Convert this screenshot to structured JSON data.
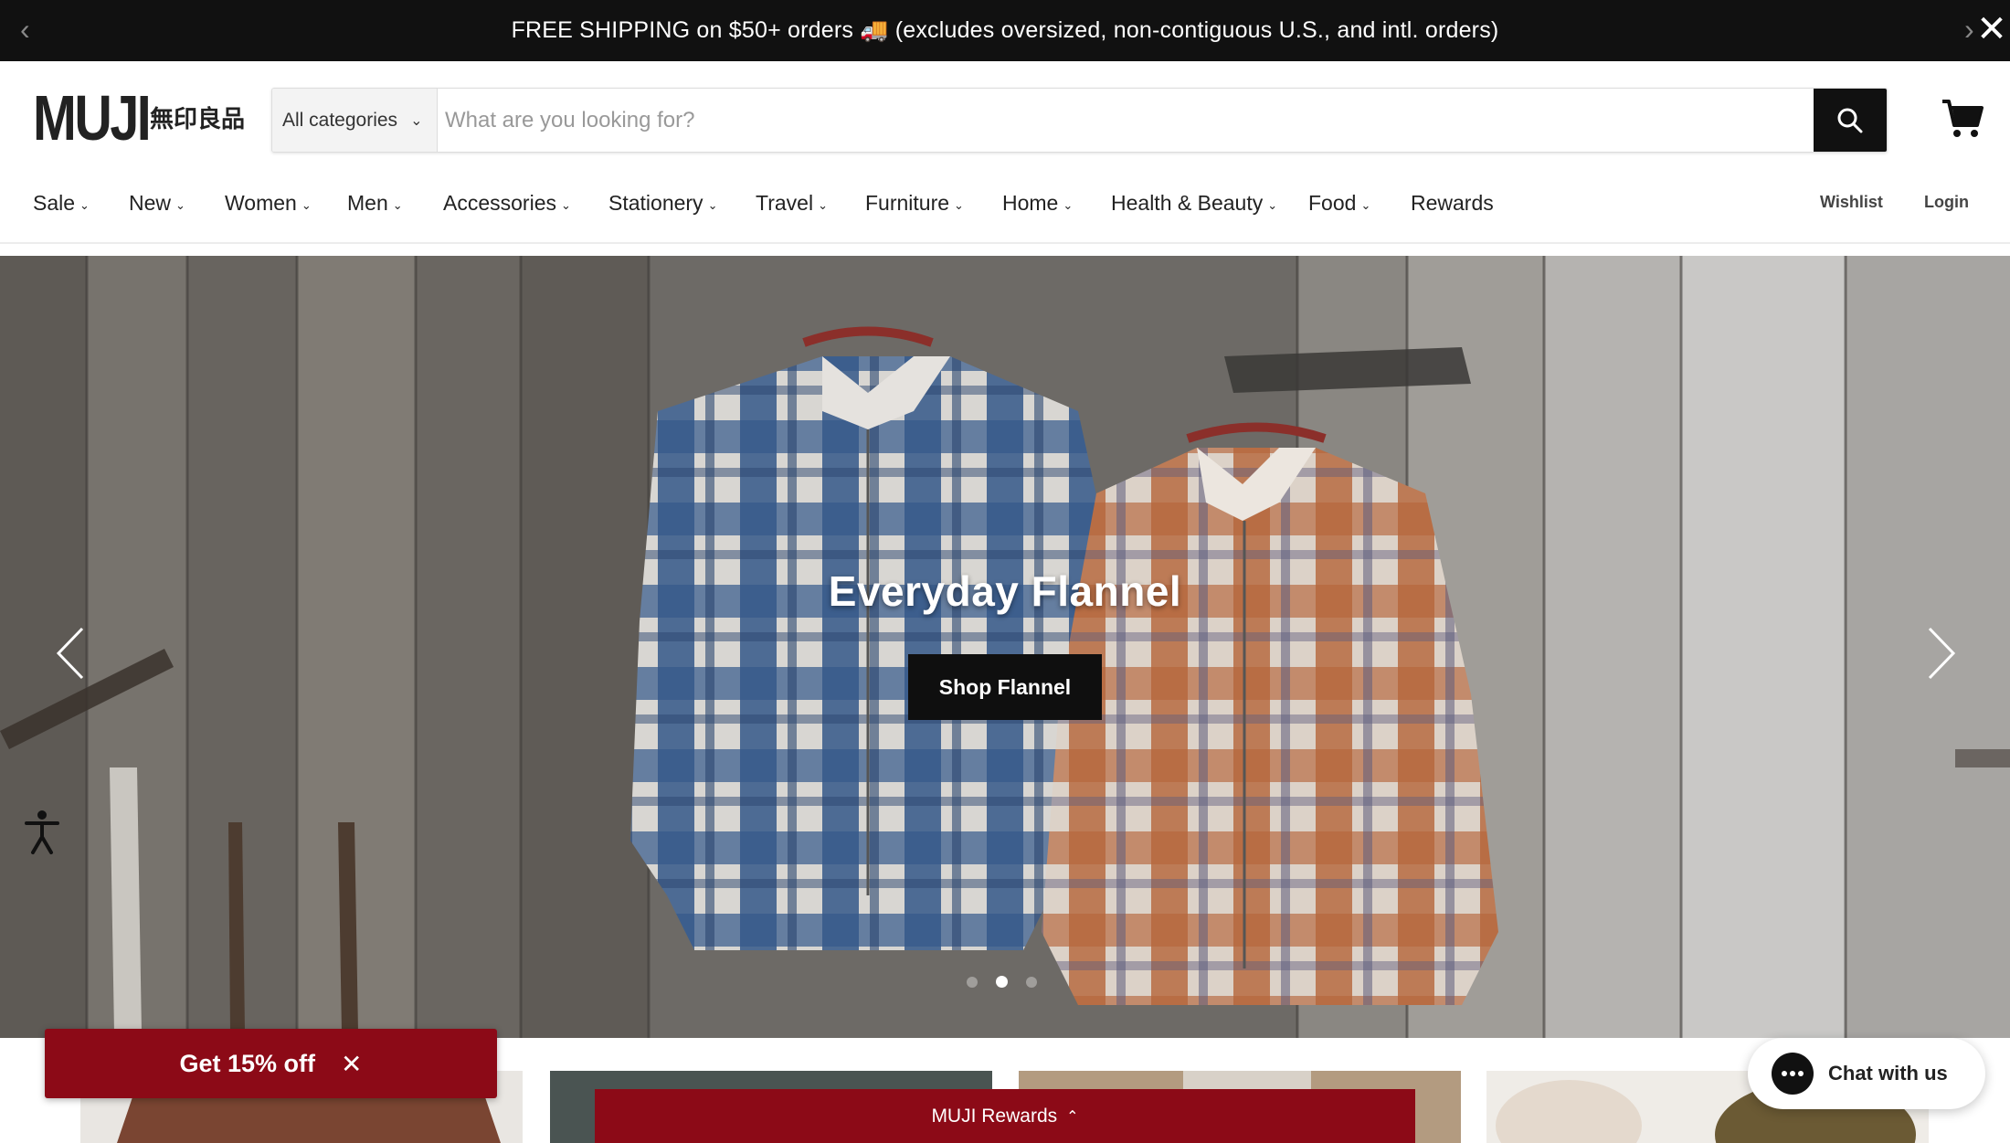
{
  "announcement": {
    "text": "FREE SHIPPING on $50+ orders 🚚 (excludes oversized, non-contiguous U.S., and intl. orders)",
    "prev_icon": "chevron-left-icon",
    "next_icon": "chevron-right-icon",
    "close_icon": "close-icon"
  },
  "header": {
    "logo_text": "MUJI",
    "logo_kanji": "無印良品",
    "search": {
      "category_label": "All categories",
      "placeholder": "What are you looking for?",
      "value": ""
    },
    "cart_icon": "cart-icon"
  },
  "nav": {
    "items": [
      {
        "label": "Sale"
      },
      {
        "label": "New"
      },
      {
        "label": "Women"
      },
      {
        "label": "Men"
      },
      {
        "label": "Accessories"
      },
      {
        "label": "Stationery"
      },
      {
        "label": "Travel"
      },
      {
        "label": "Furniture"
      },
      {
        "label": "Home"
      },
      {
        "label": "Health & Beauty"
      },
      {
        "label": "Food"
      },
      {
        "label": "Rewards"
      }
    ],
    "wishlist": "Wishlist",
    "login": "Login"
  },
  "hero": {
    "title": "Everyday Flannel",
    "cta": "Shop Flannel",
    "slide_count": 3,
    "active_slide": 2
  },
  "promo": {
    "label": "Get 15% off"
  },
  "rewards": {
    "label": "MUJI Rewards"
  },
  "chat": {
    "label": "Chat with us"
  },
  "colors": {
    "brand_red": "#8c0a17",
    "dark": "#111111"
  }
}
